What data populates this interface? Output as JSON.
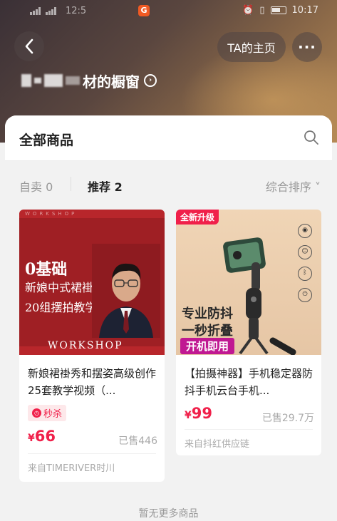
{
  "status_bar": {
    "time": "10:17",
    "carrier_time": "12:5"
  },
  "header": {
    "home_label": "TA的主页",
    "more_label": "···",
    "store_title_visible": "材的橱窗"
  },
  "panel": {
    "title": "全部商品",
    "tabs": [
      {
        "label": "自卖 0"
      },
      {
        "label": "推荐 2"
      }
    ],
    "sort_label": "综合排序 ˅"
  },
  "products": [
    {
      "thumb_top": "WORKSHOP",
      "thumb_line1": "0基础",
      "thumb_line2": "新娘中式裙褂",
      "thumb_line3": "20组摆拍教学",
      "thumb_footer": "WORKSHOP",
      "name": "新娘裙褂秀和摆姿高级创作25套教学视频（...",
      "tag": "秒杀",
      "currency": "¥",
      "price": "66",
      "sold": "已售446",
      "source": "来自TIMERIVER时川"
    },
    {
      "badge": "全新升级",
      "thumb_line1": "专业防抖",
      "thumb_line2": "一秒折叠",
      "thumb_line3": "开机即用",
      "name": "【拍摄神器】手机稳定器防抖手机云台手机...",
      "currency": "¥",
      "price": "99",
      "sold": "已售29.7万",
      "source": "来自抖红供应链"
    }
  ],
  "footer": {
    "no_more": "暂无更多商品"
  },
  "colors": {
    "accent": "#f0204a",
    "header_bg": "#5a463f"
  }
}
